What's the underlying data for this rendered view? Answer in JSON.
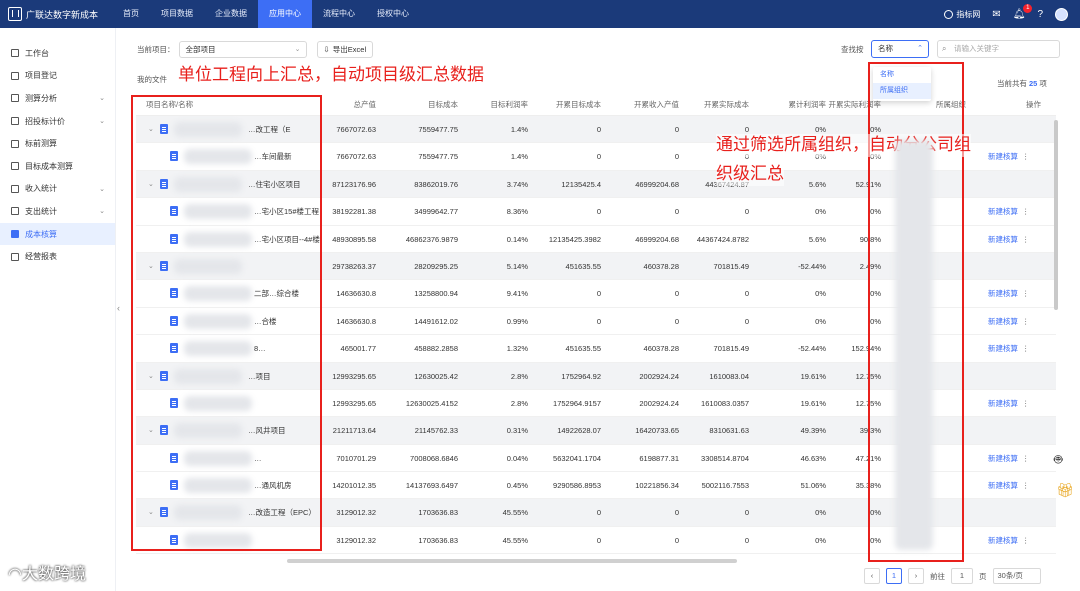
{
  "app": {
    "title": "广联达数字新成本"
  },
  "nav": {
    "items": [
      "首页",
      "项目数据",
      "企业数据",
      "应用中心",
      "流程中心",
      "授权中心"
    ],
    "active_index": 3
  },
  "topright": {
    "brand": "指标网",
    "notification_count": "1"
  },
  "sidebar": {
    "items": [
      "工作台",
      "项目登记",
      "测算分析",
      "招投标计价",
      "标前测算",
      "目标成本测算",
      "收入统计",
      "支出统计",
      "成本核算",
      "经营报表"
    ],
    "active_index": 8
  },
  "filter": {
    "project_label": "当前项目：",
    "project_value": "全部项目",
    "export_label": "导出Excel",
    "search_label": "查找按",
    "search_field": "名称",
    "search_placeholder": "请输入关键字",
    "dropdown": [
      "名称",
      "所属组织"
    ]
  },
  "file_label": "我的文件",
  "total": {
    "prefix": "当前共有",
    "count": "25",
    "suffix": "项"
  },
  "table": {
    "headers": [
      "项目名称/名称",
      "总产值",
      "目标成本",
      "目标利润率",
      "开累目标成本",
      "开累收入产值",
      "开累实际成本",
      "累计利润率",
      "开累实际利润率",
      "所属组织",
      "操作"
    ],
    "rows": [
      {
        "type": "parent",
        "name": "…改工程（E",
        "total": "7667072.63",
        "target": "7559477.75",
        "rate": "1.4%",
        "c1": "0",
        "c2": "0",
        "c3": "0",
        "c4": "0%",
        "c5": "0%",
        "action": ""
      },
      {
        "type": "child",
        "name": "…车间最新",
        "total": "7667072.63",
        "target": "7559477.75",
        "rate": "1.4%",
        "c1": "0",
        "c2": "0",
        "c3": "0",
        "c4": "0%",
        "c5": "0%",
        "action": "新建核算"
      },
      {
        "type": "parent",
        "name": "…住宅小区项目",
        "total": "87123176.96",
        "target": "83862019.76",
        "rate": "3.74%",
        "c1": "12135425.4",
        "c2": "46999204.68",
        "c3": "44367424.87",
        "c4": "5.6%",
        "c5": "52.91%",
        "action": ""
      },
      {
        "type": "child",
        "name": "…宅小区15#楼工程",
        "total": "38192281.38",
        "target": "34999642.77",
        "rate": "8.36%",
        "c1": "0",
        "c2": "0",
        "c3": "0",
        "c4": "0%",
        "c5": "0%",
        "action": "新建核算"
      },
      {
        "type": "child",
        "name": "…宅小区项目--4#楼",
        "total": "48930895.58",
        "target": "46862376.9879",
        "rate": "0.14%",
        "c1": "12135425.3982",
        "c2": "46999204.68",
        "c3": "44367424.8782",
        "c4": "5.6%",
        "c5": "90.8%",
        "action": "新建核算"
      },
      {
        "type": "parent",
        "name": "",
        "total": "29738263.37",
        "target": "28209295.25",
        "rate": "5.14%",
        "c1": "451635.55",
        "c2": "460378.28",
        "c3": "701815.49",
        "c4": "-52.44%",
        "c5": "2.49%",
        "action": ""
      },
      {
        "type": "child",
        "name": "二部…综合楼",
        "total": "14636630.8",
        "target": "13258800.94",
        "rate": "9.41%",
        "c1": "0",
        "c2": "0",
        "c3": "0",
        "c4": "0%",
        "c5": "0%",
        "action": "新建核算"
      },
      {
        "type": "child",
        "name": "…合楼",
        "total": "14636630.8",
        "target": "14491612.02",
        "rate": "0.99%",
        "c1": "0",
        "c2": "0",
        "c3": "0",
        "c4": "0%",
        "c5": "0%",
        "action": "新建核算"
      },
      {
        "type": "child",
        "name": "8…",
        "total": "465001.77",
        "target": "458882.2858",
        "rate": "1.32%",
        "c1": "451635.55",
        "c2": "460378.28",
        "c3": "701815.49",
        "c4": "-52.44%",
        "c5": "152.94%",
        "action": "新建核算"
      },
      {
        "type": "parent",
        "name": "…项目",
        "total": "12993295.65",
        "target": "12630025.42",
        "rate": "2.8%",
        "c1": "1752964.92",
        "c2": "2002924.24",
        "c3": "1610083.04",
        "c4": "19.61%",
        "c5": "12.75%",
        "action": ""
      },
      {
        "type": "child",
        "name": "",
        "total": "12993295.65",
        "target": "12630025.4152",
        "rate": "2.8%",
        "c1": "1752964.9157",
        "c2": "2002924.24",
        "c3": "1610083.0357",
        "c4": "19.61%",
        "c5": "12.75%",
        "action": "新建核算"
      },
      {
        "type": "parent",
        "name": "…风井项目",
        "total": "21211713.64",
        "target": "21145762.33",
        "rate": "0.31%",
        "c1": "14922628.07",
        "c2": "16420733.65",
        "c3": "8310631.63",
        "c4": "49.39%",
        "c5": "39.3%",
        "action": ""
      },
      {
        "type": "child",
        "name": "…",
        "total": "7010701.29",
        "target": "7008068.6846",
        "rate": "0.04%",
        "c1": "5632041.1704",
        "c2": "6198877.31",
        "c3": "3308514.8704",
        "c4": "46.63%",
        "c5": "47.21%",
        "action": "新建核算"
      },
      {
        "type": "child",
        "name": "…通风机房",
        "total": "14201012.35",
        "target": "14137693.6497",
        "rate": "0.45%",
        "c1": "9290586.8953",
        "c2": "10221856.34",
        "c3": "5002116.7553",
        "c4": "51.06%",
        "c5": "35.38%",
        "action": "新建核算"
      },
      {
        "type": "parent",
        "name": "…改造工程（EPC）",
        "total": "3129012.32",
        "target": "1703636.83",
        "rate": "45.55%",
        "c1": "0",
        "c2": "0",
        "c3": "0",
        "c4": "0%",
        "c5": "0%",
        "action": ""
      },
      {
        "type": "child",
        "name": "",
        "total": "3129012.32",
        "target": "1703636.83",
        "rate": "45.55%",
        "c1": "0",
        "c2": "0",
        "c3": "0",
        "c4": "0%",
        "c5": "0%",
        "action": "新建核算"
      }
    ]
  },
  "pager": {
    "current": "1",
    "goto_label": "前往",
    "goto_value": "1",
    "page_unit": "页",
    "page_size": "30条/页"
  },
  "annotations": {
    "left": "单位工程向上汇总，自动项目级汇总数据",
    "right_line1": "通过筛选所属组织，自动分公司组",
    "right_line2": "织级汇总"
  },
  "watermark": "大数跨境",
  "accent_color": "#3d6ef5",
  "nav_bg": "#1b3a7a"
}
